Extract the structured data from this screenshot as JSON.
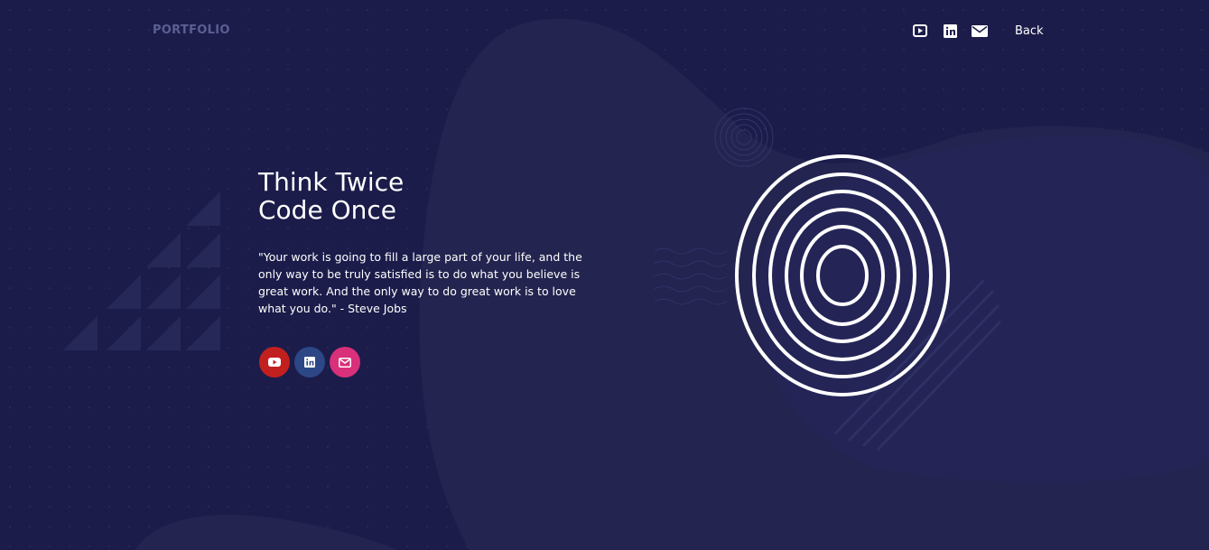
{
  "header": {
    "brand": "PORTFOLIO",
    "back_label": "Back",
    "icons": [
      "youtube-icon",
      "linkedin-icon",
      "email-icon"
    ]
  },
  "hero": {
    "title_line1": "Think Twice",
    "title_line2": "Code Once",
    "quote": "\"Your work is going to fill a large part of your life, and the only way to be truly satisfied is to do what you believe is great work. And the only way to do great work is to love what you do.\" - Steve Jobs",
    "socials": [
      {
        "icon": "youtube-icon",
        "color": "#c2201f"
      },
      {
        "icon": "linkedin-icon",
        "color": "#2d4686"
      },
      {
        "icon": "email-icon",
        "color": "#d8307a"
      }
    ]
  },
  "colors": {
    "background": "#1b1c4a",
    "blob": "#23244f",
    "brand_text": "#5b5f94",
    "text": "#ffffff"
  }
}
